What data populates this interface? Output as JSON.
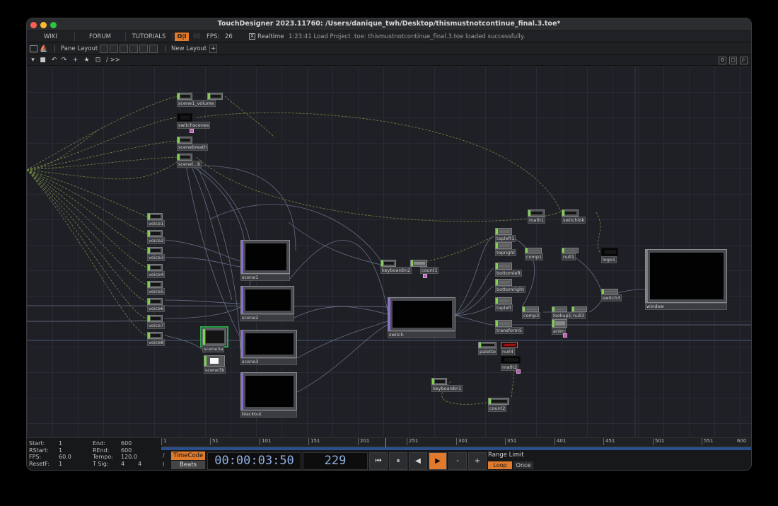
{
  "window": {
    "title": "TouchDesigner 2023.11760: /Users/danique_twh/Desktop/thismustnotcontinue_final.3.toe*"
  },
  "menubar": {
    "wiki": "WIKI",
    "forum": "FORUM",
    "tutorials": "TUTORIALS",
    "perform_button": "O|I",
    "fps_value_dim": "60",
    "fps_label": "FPS:",
    "fps_value": "26",
    "realtime_check": "X",
    "realtime_label": "Realtime",
    "status_message": "1:23:41 Load Project .toe: thismustnotcontinue_final.3.toe loaded successfully."
  },
  "panebar": {
    "pane_layout": "Pane Layout",
    "new_layout": "New Layout",
    "plus": "+"
  },
  "pathbar": {
    "path": "/ >>",
    "right_icons": [
      "0",
      "▢",
      "/-"
    ]
  },
  "operators": {
    "scene1_volume_a": "scene1_volume",
    "scene1_volume_b": "",
    "switchscenes": "switchscenes",
    "scenebreath": "scenebreath",
    "scene_b": "scenel...b",
    "voice1": "voice1",
    "voice2": "voice2",
    "voice3": "voice3",
    "voice4": "voice4",
    "voice5": "voice5",
    "voice6": "voice6",
    "voice7": "voice7",
    "voice8": "voice8",
    "scene1": "scene1",
    "scene2": "scene2",
    "scene3a": "scene3a",
    "scene3": "scene3",
    "scene3b": "scene3b",
    "blackout": "blackout",
    "keyboardin2": "keyboardin2",
    "count1": "count1",
    "switch": "switch",
    "keyboardin1": "keyboardin1",
    "count2": "count2",
    "topleft1": "topleft1",
    "topright": "topright",
    "bottomleft": "bottomleft",
    "bottomright": "bottomright",
    "topleft": "topleft",
    "transform5": "transform5",
    "comp1": "comp1",
    "null1": "null1",
    "logo1": "logo1",
    "math1": "math1",
    "switch2": "switchlok",
    "switch3": "switch3",
    "comp3": "comp3",
    "lookup1": "lookup1",
    "null3": "null3",
    "anim": "anim",
    "palette": "palette",
    "null4": "null4",
    "math2": "math2",
    "window": "window"
  },
  "timeline": {
    "start_label": "Start:",
    "start_value": "1",
    "end_label": "End:",
    "end_value": "600",
    "rstart_label": "RStart:",
    "rstart_value": "1",
    "rend_label": "REnd:",
    "rend_value": "600",
    "fps_label": "FPS:",
    "fps_value": "60.0",
    "tempo_label": "Tempo:",
    "tempo_value": "120.0",
    "resetf_label": "ResetF:",
    "resetf_value": "1",
    "tsig_label": "T Sig:",
    "tsig_value_a": "4",
    "tsig_value_b": "4",
    "ruler_ticks": [
      "1",
      "51",
      "101",
      "151",
      "201",
      "251",
      "301",
      "351",
      "401",
      "451",
      "501",
      "551",
      "600"
    ],
    "slash": "/",
    "pipe": "I",
    "timecode_button": "TimeCode",
    "beats_button": "Beats",
    "timecode": "00:00:03:50",
    "frame": "229",
    "range_limit": "Range Limit",
    "loop": "Loop",
    "once": "Once"
  },
  "transport": {
    "rewind": "⏮",
    "pause": "⏸",
    "step_back": "◀",
    "play": "▶",
    "minus": "-",
    "plus": "+"
  }
}
